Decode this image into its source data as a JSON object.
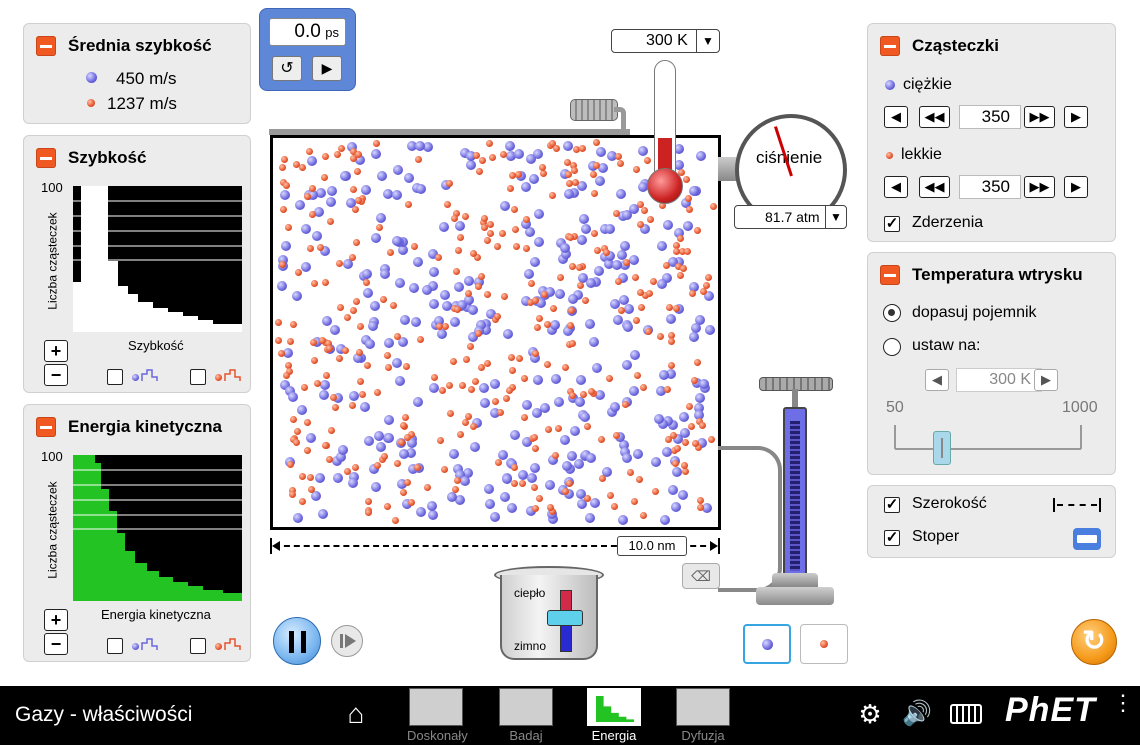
{
  "timer": {
    "value": "0.0",
    "unit": "ps"
  },
  "avg_speed": {
    "title": "Średnia szybkość",
    "heavy": "450 m/s",
    "light": "1237 m/s"
  },
  "speed_panel": {
    "title": "Szybkość",
    "y_max": "100",
    "y_label": "Liczba cząsteczek",
    "x_label": "Szybkość",
    "plus": "+",
    "minus": "−"
  },
  "energy_panel": {
    "title": "Energia kinetyczna",
    "y_max": "100",
    "y_label": "Liczba cząsteczek",
    "x_label": "Energia kinetyczna",
    "plus": "+",
    "minus": "−"
  },
  "thermometer": {
    "value": "300 K"
  },
  "pressure": {
    "label": "ciśnienie",
    "value": "81.7 atm"
  },
  "ruler": {
    "value": "10.0 nm"
  },
  "heater": {
    "hot": "ciepło",
    "cold": "zimno"
  },
  "particles": {
    "title": "Cząsteczki",
    "heavy_label": "ciężkie",
    "heavy_count": "350",
    "light_label": "lekkie",
    "light_count": "350",
    "collisions": "Zderzenia"
  },
  "injection": {
    "title": "Temperatura wtrysku",
    "opt_fit": "dopasuj pojemnik",
    "opt_set": "ustaw na:",
    "value": "300 K",
    "min": "50",
    "max": "1000"
  },
  "options": {
    "width": "Szerokość",
    "stopwatch": "Stoper"
  },
  "navbar": {
    "app_title": "Gazy - właściwości",
    "tabs": [
      "Doskonały",
      "Badaj",
      "Energia",
      "Dyfuzja"
    ],
    "active_tab": "Energia",
    "brand": "PhET"
  },
  "colors": {
    "heavy": "#6b66dd",
    "light": "#e5542c",
    "accent": "#f05a22",
    "nav": "#000000",
    "active_tab": "#ffffff"
  }
}
